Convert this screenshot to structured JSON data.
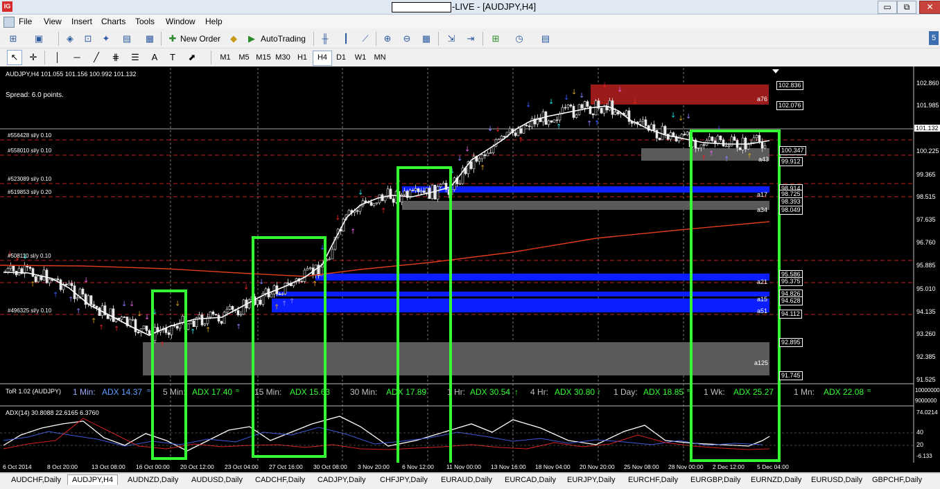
{
  "window": {
    "title": "-LIVE - [AUDJPY,H4]",
    "app_icon": "IG",
    "min": "▭",
    "max": "⧉",
    "close": "✕"
  },
  "menu": [
    "File",
    "View",
    "Insert",
    "Charts",
    "Tools",
    "Window",
    "Help"
  ],
  "toolbar": {
    "new_order": "New Order",
    "autotrading": "AutoTrading"
  },
  "timeframes": [
    "M1",
    "M5",
    "M15",
    "M30",
    "H1",
    "H4",
    "D1",
    "W1",
    "MN"
  ],
  "active_timeframe": "H4",
  "chart": {
    "header": "AUDJPY,H4  101.055 101.156 100.992 101.132",
    "spread": "Spread: 6.0 points.",
    "current_price": "101.132",
    "y_axis_labels": [
      "102.860",
      "101.985",
      "101.132",
      "100.225",
      "99.365",
      "98.515",
      "97.635",
      "96.760",
      "95.885",
      "95.010",
      "94.135",
      "93.260",
      "92.385",
      "91.525"
    ],
    "price_boxes": [
      "102.836",
      "102.076",
      "100.347",
      "99.912",
      "98.914",
      "98.725",
      "98.393",
      "98.049",
      "95.586",
      "95.375",
      "94.826",
      "94.628",
      "94.112",
      "92.895",
      "91.745"
    ],
    "zone_labels": [
      "a76",
      "a43",
      "a17",
      "a34",
      "a21",
      "a15",
      "a51",
      "a125"
    ],
    "order_labels": [
      "#556428 sl/y 0.10",
      "#558010 sl/y 0.10",
      "#523089 sl/y 0.10",
      "#519853 sl/y 0.20",
      "#508110 sl/y 0.10",
      "#496325 sl/y 0.10"
    ],
    "x_axis_labels": [
      "6 Oct 2014",
      "8 Oct 20:00",
      "13 Oct 08:00",
      "16 Oct 00:00",
      "20 Oct 12:00",
      "23 Oct 04:00",
      "27 Oct 16:00",
      "30 Oct 08:00",
      "3 Nov 20:00",
      "6 Nov 12:00",
      "11 Nov 00:00",
      "13 Nov 16:00",
      "18 Nov 04:00",
      "20 Nov 20:00",
      "25 Nov 08:00",
      "28 Nov 00:00",
      "2 Dec 12:00",
      "5 Dec 04:00"
    ]
  },
  "tor_panel": {
    "title": "ToR 1.02 (AUDJPY)",
    "items": [
      {
        "tf": "1 Min:",
        "adx": "ADX 14.37"
      },
      {
        "tf": "5 Min:",
        "adx": "ADX 17.40"
      },
      {
        "tf": "15 Min:",
        "adx": "ADX 15.63"
      },
      {
        "tf": "30 Min:",
        "adx": "ADX 17.89"
      },
      {
        "tf": "1 Hr:",
        "adx": "ADX 30.54"
      },
      {
        "tf": "4 Hr:",
        "adx": "ADX 30.80"
      },
      {
        "tf": "1 Day:",
        "adx": "ADX 18.85"
      },
      {
        "tf": "1 Wk:",
        "adx": "ADX 25.27"
      },
      {
        "tf": "1 Mn:",
        "adx": "ADX 22.08"
      }
    ],
    "y_labels": [
      "10000000",
      "9000000"
    ]
  },
  "adx_panel": {
    "title": "ADX(14) 30.8088 22.6165 6.3760",
    "y_labels": [
      "74.0214",
      "40",
      "20",
      "-6.133"
    ]
  },
  "tabs": [
    "AUDCHF,Daily",
    "AUDJPY,H4",
    "AUDNZD,Daily",
    "AUDUSD,Daily",
    "CADCHF,Daily",
    "CADJPY,Daily",
    "CHFJPY,Daily",
    "EURAUD,Daily",
    "EURCAD,Daily",
    "EURJPY,Daily",
    "EURCHF,Daily",
    "EURGBP,Daily",
    "EURNZD,Daily",
    "EURUSD,Daily",
    "GBPCHF,Daily"
  ],
  "active_tab": "AUDJPY,H4",
  "colors": {
    "highlight_box": "#33ff33",
    "ma_white": "#ffffff",
    "ma_red": "#e03c1c",
    "zone_blue": "#0a1eff",
    "zone_gray": "#5a5a5a",
    "zone_red": "#9b1b1b"
  }
}
